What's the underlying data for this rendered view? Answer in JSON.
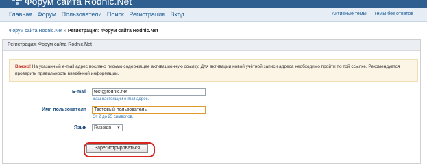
{
  "header": {
    "site_title": "Форум сайта Rodnic.Net",
    "logo_icon": "snowflake-logo-icon"
  },
  "nav": {
    "items": [
      {
        "label": "Главная"
      },
      {
        "label": "Форум"
      },
      {
        "label": "Пользователи"
      },
      {
        "label": "Поиск"
      },
      {
        "label": "Регистрация"
      },
      {
        "label": "Вход"
      }
    ],
    "right_links": [
      {
        "label": "Активные темы"
      },
      {
        "label": "Темы без ответов"
      }
    ]
  },
  "breadcrumb": {
    "root": "Форум сайта Rodnic.Net",
    "separator": "»",
    "current": "Регистрация: Форум сайта Rodnic.Net"
  },
  "panel": {
    "title": "Регистрация: Форум сайта Rodnic.Net",
    "notice": {
      "important_label": "Важно!",
      "text": "На указанный e-mail адрес послано письмо содержащее активационную ссылку. Для активации новой учётной записи адреса необходимо пройти по той ссылке. Рекомендуется проверить правильность введённой информации."
    },
    "form": {
      "email": {
        "label": "E-mail",
        "value": "test@rodnic.net",
        "hint": "Ваш настоящий e-mail адрес."
      },
      "username": {
        "label": "Имя пользователя",
        "value": "Тестовый пользователь",
        "hint": "От 2 до 25 символов."
      },
      "language": {
        "label": "Язык",
        "selected": "Russian"
      },
      "submit_label": "Зарегистрироваться"
    }
  },
  "colors": {
    "header_bg": "#2f5f90",
    "navbar_bg": "#e6edf4",
    "link": "#1d5c95",
    "notice_bg": "#fcf5e6",
    "important": "#c0392b",
    "highlight_ring": "#d7261f",
    "focus_border": "#e09a2b"
  }
}
